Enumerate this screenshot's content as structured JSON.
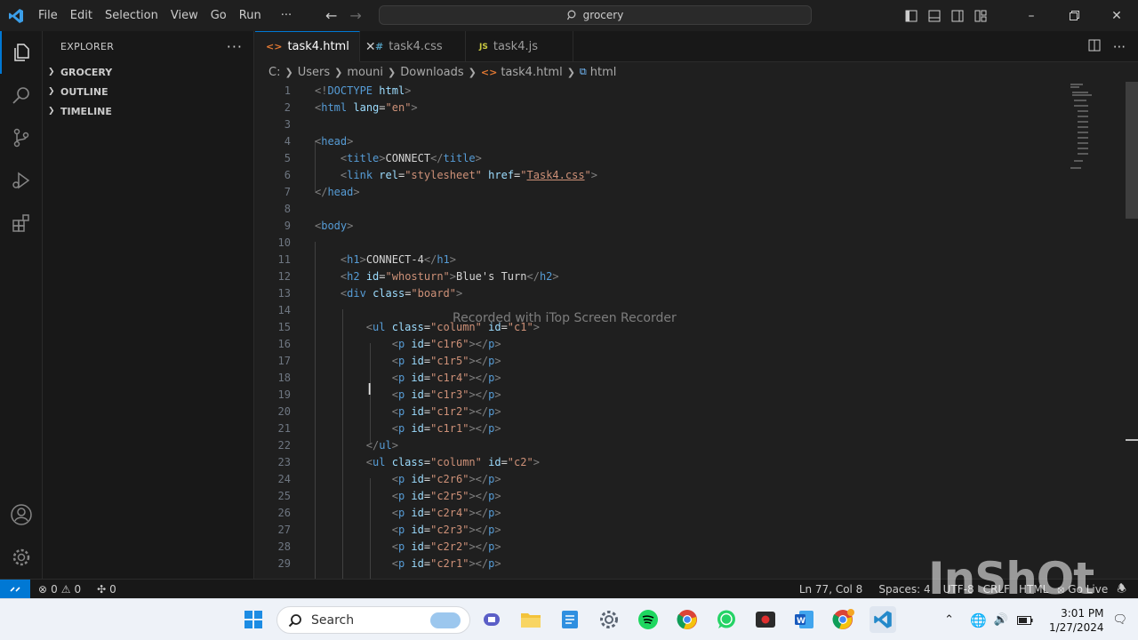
{
  "titlebar": {
    "menu": [
      "File",
      "Edit",
      "Selection",
      "View",
      "Go",
      "Run",
      "···"
    ],
    "search": "grocery"
  },
  "sidebar": {
    "title": "EXPLORER",
    "sections": [
      "GROCERY",
      "OUTLINE",
      "TIMELINE"
    ]
  },
  "tabs": [
    {
      "label": "task4.html",
      "icon": "<>",
      "icon_color": "#e37933",
      "active": true
    },
    {
      "label": "task4.css",
      "icon": "#",
      "icon_color": "#519aba",
      "active": false
    },
    {
      "label": "task4.js",
      "icon": "JS",
      "icon_color": "#cbcb41",
      "active": false
    }
  ],
  "breadcrumb": [
    "C:",
    "Users",
    "mouni",
    "Downloads",
    "task4.html",
    "html"
  ],
  "editor": {
    "line_numbers": [
      "1",
      "2",
      "3",
      "4",
      "5",
      "6",
      "7",
      "8",
      "9",
      "10",
      "11",
      "12",
      "13",
      "14",
      "15",
      "16",
      "17",
      "18",
      "19",
      "20",
      "21",
      "22",
      "23",
      "24",
      "25",
      "26",
      "27",
      "28",
      "29"
    ],
    "watermark": "Recorded with iTop Screen Recorder"
  },
  "statusbar": {
    "errors": "0",
    "warnings": "0",
    "ports": "0",
    "position": "Ln 77, Col 8",
    "spaces": "Spaces: 4",
    "encoding": "UTF-8",
    "eol": "CRLF",
    "language": "HTML",
    "golive": "Go Live",
    "overlay": "InShOt"
  },
  "taskbar": {
    "search_placeholder": "Search",
    "time": "3:01 PM",
    "date": "1/27/2024"
  },
  "colors": {
    "accent": "#0078d4",
    "tag": "#569cd6",
    "attribute": "#9cdcfe",
    "string": "#ce9178"
  }
}
